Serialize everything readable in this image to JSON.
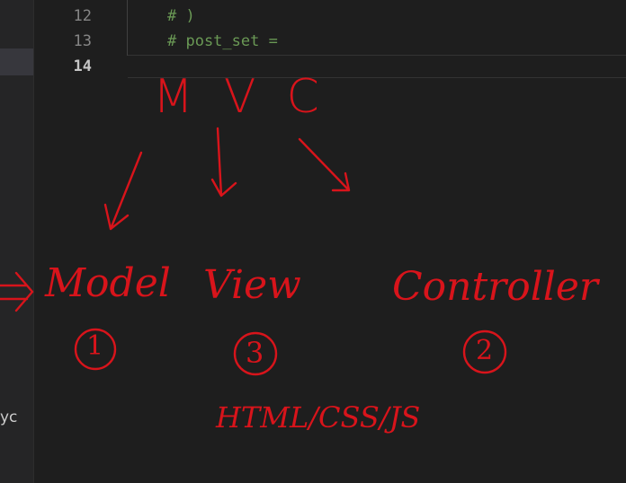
{
  "sidebar": {
    "partial_text": "yc"
  },
  "editor": {
    "lines": [
      {
        "number": "12",
        "code": "# )"
      },
      {
        "number": "13",
        "code": "# post_set ="
      },
      {
        "number": "14",
        "code": ""
      }
    ]
  },
  "annotation": {
    "heading": "MVC",
    "model": "Model",
    "view": "View",
    "controller": "Controller",
    "model_order": "1",
    "view_order": "3",
    "controller_order": "2",
    "view_tech": "HTML/CSS/JS",
    "ink_color": "#d8141b"
  }
}
